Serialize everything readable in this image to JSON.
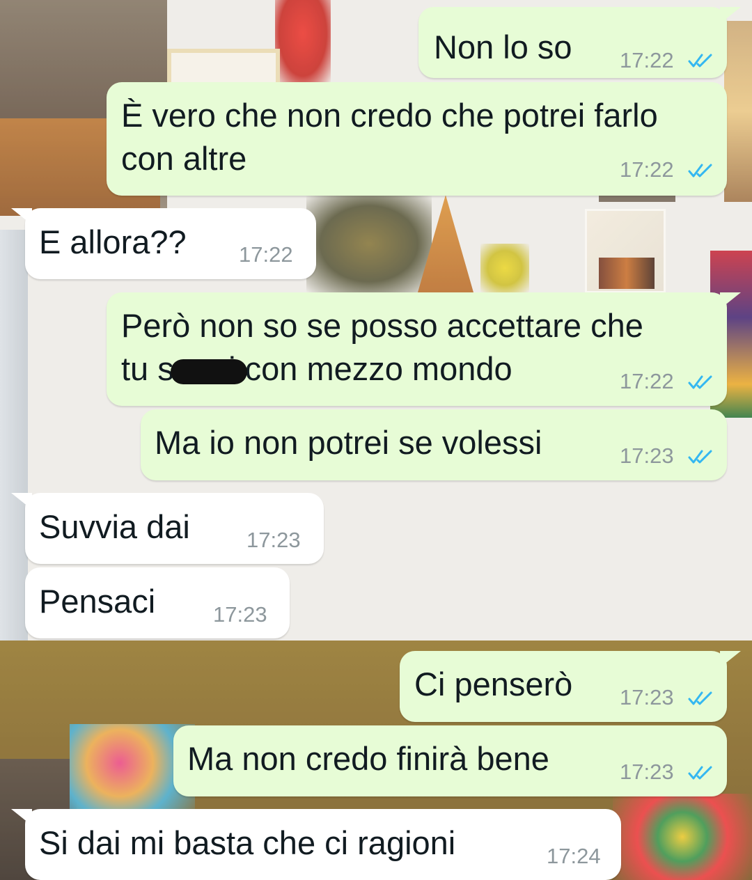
{
  "chat": {
    "accent_tick_color": "#34b7f1",
    "outgoing_bubble_color": "#e7fcd6",
    "incoming_bubble_color": "#ffffff",
    "messages": [
      {
        "direction": "out",
        "text": "Non lo so",
        "time": "17:22",
        "status": "read"
      },
      {
        "direction": "out",
        "text": "È vero che non credo che potrei farlo\ncon altre",
        "time": "17:22",
        "status": "read"
      },
      {
        "direction": "in",
        "text": "E allora??",
        "time": "17:22"
      },
      {
        "direction": "out",
        "text": "Però non so se posso accettare che\ntu s      i con mezzo mondo",
        "time": "17:22",
        "status": "read",
        "redacted": true
      },
      {
        "direction": "out",
        "text": "Ma io non potrei se volessi",
        "time": "17:23",
        "status": "read"
      },
      {
        "direction": "in",
        "text": "Suvvia dai",
        "time": "17:23"
      },
      {
        "direction": "in",
        "text": "Pensaci",
        "time": "17:23"
      },
      {
        "direction": "out",
        "text": "Ci penserò",
        "time": "17:23",
        "status": "read"
      },
      {
        "direction": "out",
        "text": "Ma non credo finirà bene",
        "time": "17:23",
        "status": "read"
      },
      {
        "direction": "in",
        "text": "Si dai mi basta che ci ragioni",
        "time": "17:24"
      }
    ]
  }
}
